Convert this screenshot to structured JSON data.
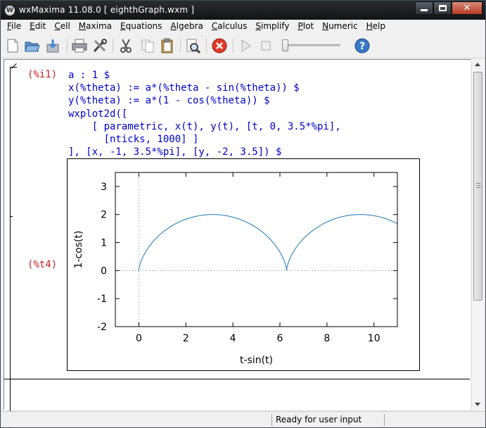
{
  "window": {
    "title": "wxMaxima 11.08.0  [ eighthGraph.wxm ]",
    "app_icon": "W"
  },
  "menu": [
    {
      "label": "File",
      "mnemonic": "F"
    },
    {
      "label": "Edit",
      "mnemonic": "E"
    },
    {
      "label": "Cell",
      "mnemonic": "C"
    },
    {
      "label": "Maxima",
      "mnemonic": "M"
    },
    {
      "label": "Equations",
      "mnemonic": "E"
    },
    {
      "label": "Algebra",
      "mnemonic": "A"
    },
    {
      "label": "Calculus",
      "mnemonic": "C"
    },
    {
      "label": "Simplify",
      "mnemonic": "S"
    },
    {
      "label": "Plot",
      "mnemonic": "P"
    },
    {
      "label": "Numeric",
      "mnemonic": "N"
    },
    {
      "label": "Help",
      "mnemonic": "H"
    }
  ],
  "toolbar": {
    "icons": [
      "new-document-icon",
      "open-folder-icon",
      "save-icon",
      "print-icon",
      "preferences-icon",
      "cut-icon",
      "copy-icon",
      "paste-icon",
      "find-icon",
      "interrupt-icon",
      "play-icon",
      "stop-icon",
      "slider-icon",
      "help-icon"
    ]
  },
  "cell": {
    "input_label": "(%i1)",
    "output_label": "(%t4)",
    "code_lines": [
      "a : 1 $",
      "x(%theta) := a*(%theta - sin(%theta)) $",
      "y(%theta) := a*(1 - cos(%theta)) $",
      "wxplot2d([",
      "    [ parametric, x(t), y(t), [t, 0, 3.5*%pi],",
      "      [nticks, 1000] ]",
      "], [x, -1, 3.5*%pi], [y, -2, 3.5]) $"
    ]
  },
  "chart_data": {
    "type": "line",
    "xlabel": "t-sin(t)",
    "ylabel": "1-cos(t)",
    "xlim": [
      -1,
      10.9956
    ],
    "ylim": [
      -2,
      3.5
    ],
    "x_ticks": [
      0,
      2,
      4,
      6,
      8,
      10
    ],
    "y_ticks": [
      -2,
      -1,
      0,
      1,
      2,
      3
    ],
    "zero_axes": true,
    "series": [
      {
        "curve": "cycloid",
        "param_range": [
          0,
          10.9956
        ],
        "samples": 1000,
        "color": "#1f77b4"
      }
    ]
  },
  "status": {
    "text": "Ready for user input"
  },
  "colors": {
    "code": "#0000c8",
    "labels": "#c82020",
    "curve": "#1f77b4"
  }
}
